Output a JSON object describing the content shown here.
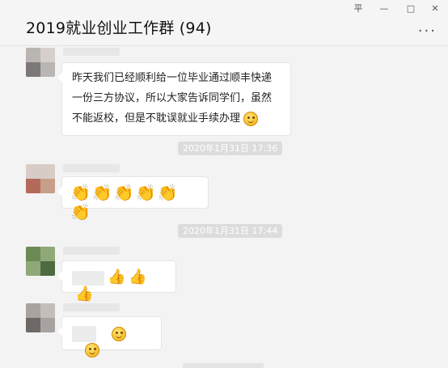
{
  "window": {
    "title": "2019就业创业工作群 (94)",
    "controls": {
      "pin": "平",
      "minimize": "—",
      "maximize": "□",
      "close": "✕"
    },
    "more": "···"
  },
  "messages": [
    {
      "type": "text",
      "text": "昨天我们已经顺利给一位毕业通过顺丰快递一份三方协议，所以大家告诉同学们，虽然不能返校，但是不耽误就业手续办理",
      "emoji": "smile-icon"
    },
    {
      "type": "timestamp",
      "text": "2020年1月31日 17:36"
    },
    {
      "type": "emoji-row",
      "emoji": "clapping-hands-icon",
      "glyph": "👏",
      "count": 6
    },
    {
      "type": "timestamp",
      "text": "2020年1月31日 17:44"
    },
    {
      "type": "emoji-row",
      "emoji": "thumbs-up-icon",
      "glyph": "👍",
      "count": 3
    },
    {
      "type": "emoji-row",
      "emoji": "smile-icon",
      "count": 2
    }
  ],
  "colors": {
    "background": "#f3f3f3",
    "bubble": "#ffffff",
    "timestamp_bg": "#dcdcdc",
    "emoji_yellow": "#f7bf26"
  }
}
